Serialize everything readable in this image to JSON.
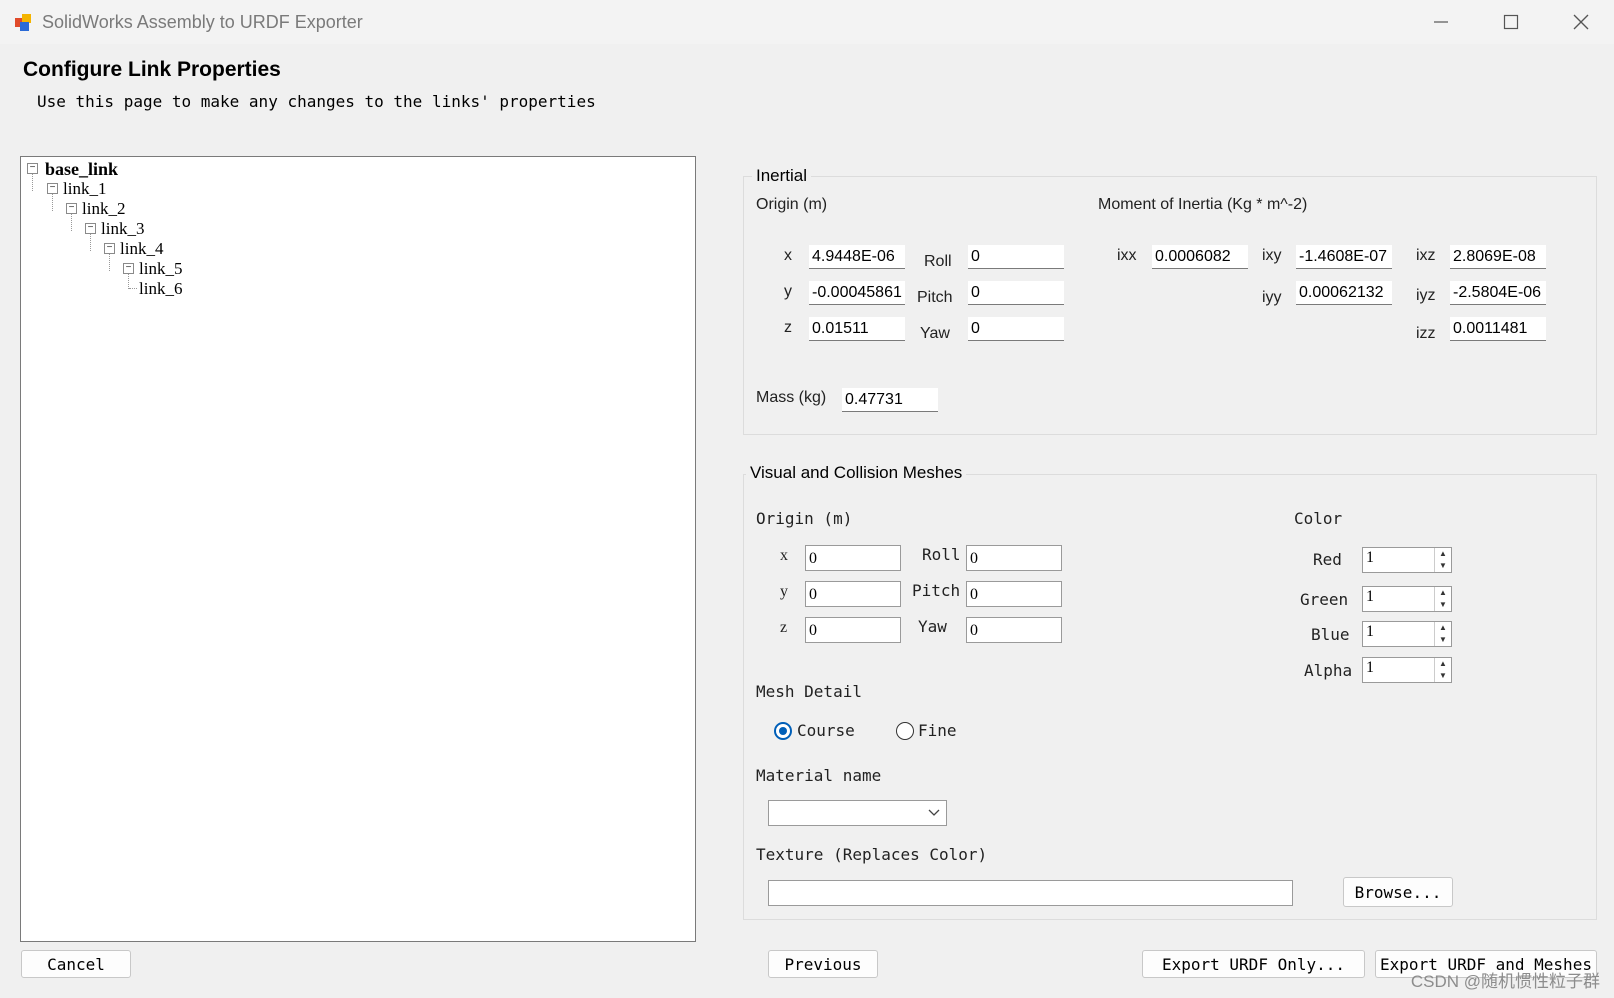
{
  "window": {
    "title": "SolidWorks Assembly to URDF Exporter",
    "minimize_icon": "minimize-icon",
    "maximize_icon": "maximize-icon",
    "close_icon": "close-icon"
  },
  "header": {
    "title": "Configure Link Properties",
    "subtitle": "Use this page to make any changes to the links' properties"
  },
  "tree": {
    "nodes": [
      "base_link",
      "link_1",
      "link_2",
      "link_3",
      "link_4",
      "link_5",
      "link_6"
    ]
  },
  "inertial": {
    "title": "Inertial",
    "origin_label": "Origin (m)",
    "moment_label": "Moment of Inertia (Kg * m^-2)",
    "x_label": "x",
    "y_label": "y",
    "z_label": "z",
    "roll_label": "Roll",
    "pitch_label": "Pitch",
    "yaw_label": "Yaw",
    "x": "4.9448E-06",
    "y": "-0.00045861",
    "z": "0.01511",
    "roll": "0",
    "pitch": "0",
    "yaw": "0",
    "ixx_label": "ixx",
    "ixy_label": "ixy",
    "ixz_label": "ixz",
    "iyy_label": "iyy",
    "iyz_label": "iyz",
    "izz_label": "izz",
    "ixx": "0.0006082",
    "ixy": "-1.4608E-07",
    "ixz": "2.8069E-08",
    "iyy": "0.00062132",
    "iyz": "-2.5804E-06",
    "izz": "0.0011481",
    "mass_label": "Mass (kg)",
    "mass": "0.47731"
  },
  "visual": {
    "title": "Visual and Collision Meshes",
    "origin_label": "Origin (m)",
    "x_label": "x",
    "y_label": "y",
    "z_label": "z",
    "roll_label": "Roll",
    "pitch_label": "Pitch",
    "yaw_label": "Yaw",
    "x": "0",
    "y": "0",
    "z": "0",
    "roll": "0",
    "pitch": "0",
    "yaw": "0",
    "color_label": "Color",
    "red_label": "Red",
    "green_label": "Green",
    "blue_label": "Blue",
    "alpha_label": "Alpha",
    "red": "1",
    "green": "1",
    "blue": "1",
    "alpha": "1",
    "mesh_detail_label": "Mesh Detail",
    "course_label": "Course",
    "fine_label": "Fine",
    "selected_detail": "Course",
    "material_label": "Material name",
    "material_value": "",
    "texture_label": "Texture (Replaces Color)",
    "texture_value": "",
    "browse_label": "Browse..."
  },
  "buttons": {
    "cancel": "Cancel",
    "previous": "Previous",
    "export_urdf_only": "Export URDF Only...",
    "export_urdf_meshes": "Export URDF and Meshes"
  },
  "watermark": "CSDN @随机惯性粒子群"
}
